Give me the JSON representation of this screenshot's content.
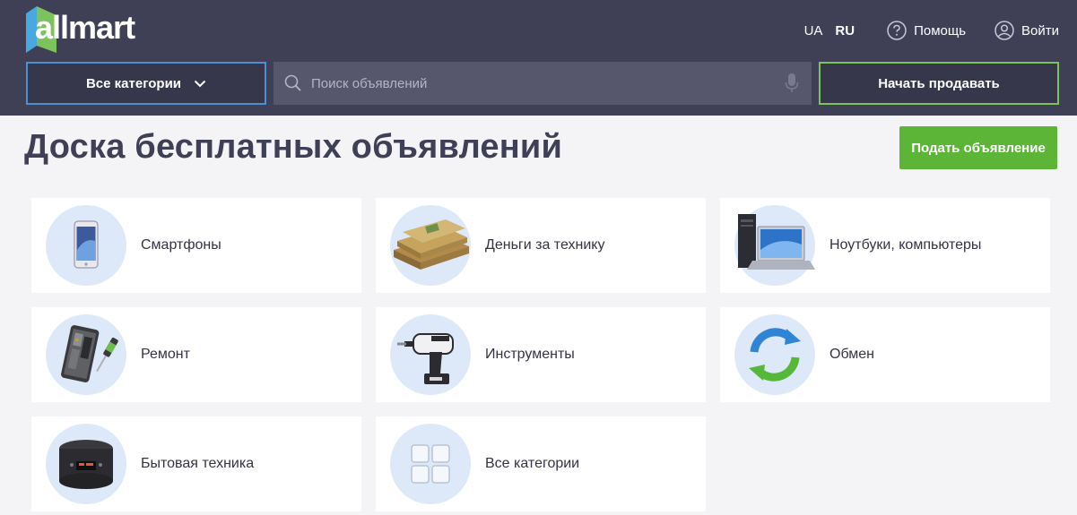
{
  "header": {
    "logo_text": "allmart",
    "languages": [
      {
        "code": "UA",
        "active": false
      },
      {
        "code": "RU",
        "active": true
      }
    ],
    "help_label": "Помощь",
    "login_label": "Войти",
    "category_select_label": "Все категории",
    "search_placeholder": "Поиск объявлений",
    "sell_button_label": "Начать продавать"
  },
  "main": {
    "title": "Доска бесплатных объявлений",
    "post_button_label": "Подать объявление",
    "categories": [
      {
        "label": "Смартфоны",
        "icon": "smartphone-icon"
      },
      {
        "label": "Деньги за технику",
        "icon": "money-stack-icon"
      },
      {
        "label": "Ноутбуки, компьютеры",
        "icon": "laptop-computer-icon"
      },
      {
        "label": "Ремонт",
        "icon": "phone-repair-icon"
      },
      {
        "label": "Инструменты",
        "icon": "drill-icon"
      },
      {
        "label": "Обмен",
        "icon": "exchange-arrows-icon"
      },
      {
        "label": "Бытовая техника",
        "icon": "multicooker-icon"
      },
      {
        "label": "Все категории",
        "icon": "grid-icon"
      }
    ]
  },
  "colors": {
    "header_bg": "#3f3f56",
    "accent_green": "#5cb536",
    "accent_blue": "#4c8fd3",
    "page_bg": "#f4f4f7"
  }
}
